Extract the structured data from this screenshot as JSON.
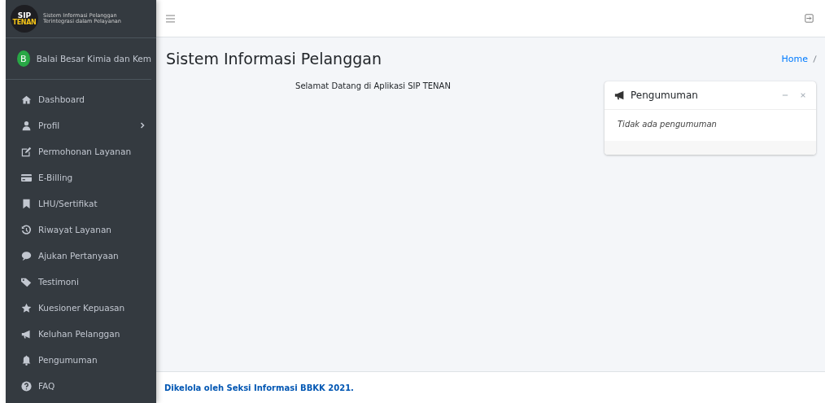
{
  "brand": {
    "logo_top": "SIP",
    "logo_bottom": "TENAN",
    "line_1": "Sistem Informasi Pelanggan",
    "line_2": "Terintegrasi dalam Pelayanan"
  },
  "user": {
    "initial": "B",
    "name": "Balai Besar Kimia dan Kem"
  },
  "sidebar": {
    "items": [
      {
        "label": "Dashboard",
        "expandable": false
      },
      {
        "label": "Profil",
        "expandable": true
      },
      {
        "label": "Permohonan Layanan",
        "expandable": false
      },
      {
        "label": "E-Billing",
        "expandable": false
      },
      {
        "label": "LHU/Sertifikat",
        "expandable": false
      },
      {
        "label": "Riwayat Layanan",
        "expandable": false
      },
      {
        "label": "Ajukan Pertanyaan",
        "expandable": false
      },
      {
        "label": "Testimoni",
        "expandable": false
      },
      {
        "label": "Kuesioner Kepuasan",
        "expandable": false
      },
      {
        "label": "Keluhan Pelanggan",
        "expandable": false
      },
      {
        "label": "Pengumuman",
        "expandable": false
      },
      {
        "label": "FAQ",
        "expandable": false
      }
    ]
  },
  "page": {
    "title": "Sistem Informasi Pelanggan",
    "breadcrumb": [
      "Home"
    ],
    "welcome": "Selamat Datang di Aplikasi SIP TENAN"
  },
  "announcement_card": {
    "title": "Pengumuman",
    "body": "Tidak ada pengumuman"
  },
  "footer": {
    "text": "Dikelola oleh Seksi Informasi BBKK 2021."
  }
}
